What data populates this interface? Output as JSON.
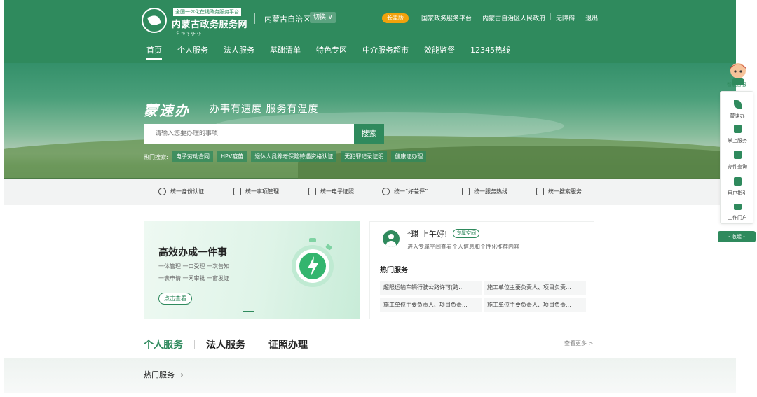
{
  "header": {
    "logo_tag": "全国一体化在线政务服务平台",
    "logo_name": "内蒙古政务服务网",
    "logo_mongol": "ᠮ ᠤ ᠨ ᠭ ᠭ",
    "region": "内蒙古自治区",
    "switch_label": "切换 ∨",
    "elder_label": "长辈版",
    "links": [
      "国家政务服务平台",
      "内蒙古自治区人民政府",
      "无障碍",
      "退出"
    ],
    "nav": [
      "首页",
      "个人服务",
      "法人服务",
      "基础清单",
      "特色专区",
      "中介服务超市",
      "效能监督",
      "12345热线"
    ],
    "active_nav": "首页"
  },
  "hero": {
    "brand": "蒙速办",
    "slogan": "办事有速度 服务有温度",
    "search_placeholder": "请输入您要办理的事项",
    "search_button": "搜索",
    "hot_label": "热门搜索:",
    "hot_tags": [
      "电子劳动合同",
      "HPV疫苗",
      "退休人员养老保险待遇资格认证",
      "无犯罪记录证明",
      "健康证办理"
    ]
  },
  "unified_bar": [
    {
      "label": "统一身份认证",
      "icon": "identity-icon"
    },
    {
      "label": "统一事项管理",
      "icon": "list-icon"
    },
    {
      "label": "统一电子证照",
      "icon": "license-icon"
    },
    {
      "label": "统一“好差评”",
      "icon": "rating-icon"
    },
    {
      "label": "统一服务热线",
      "icon": "hotline-icon"
    },
    {
      "label": "统一搜索服务",
      "icon": "search-service-icon"
    }
  ],
  "banner": {
    "title": "高效办成一件事",
    "sub1": "一体管理 一口受理 一次告知",
    "sub2": "一表申请 一网审批 一窗发证",
    "button": "点击查看"
  },
  "user_card": {
    "greeting": "*琪 上午好!",
    "space_badge": "专属空间",
    "sub": "进入专属空间查看个人信息和个性化推荐内容",
    "hot_title": "热门服务",
    "services": [
      "超限运输车辆行驶公路许可(跨...",
      "施工单位主要负责人、项目负责...",
      "施工单位主要负责人、项目负责...",
      "施工单位主要负责人、项目负责..."
    ]
  },
  "tabs": [
    "个人服务",
    "法人服务",
    "证照办理"
  ],
  "active_tab": "个人服务",
  "more_link": "查看更多 >",
  "section_title": "热门服务 →",
  "sidebar": {
    "robot_label": "智能客服",
    "items": [
      {
        "label": "蒙速办",
        "icon": "mengsuban-icon"
      },
      {
        "label": "掌上服务",
        "icon": "mobile-icon"
      },
      {
        "label": "办件查询",
        "icon": "query-icon"
      },
      {
        "label": "用户指引",
        "icon": "guide-icon"
      },
      {
        "label": "工作门户",
        "icon": "portal-icon"
      }
    ],
    "collapse": "- 收起 -"
  },
  "colors": {
    "brand": "#2f8a5d",
    "elder": "#f2a20c"
  }
}
